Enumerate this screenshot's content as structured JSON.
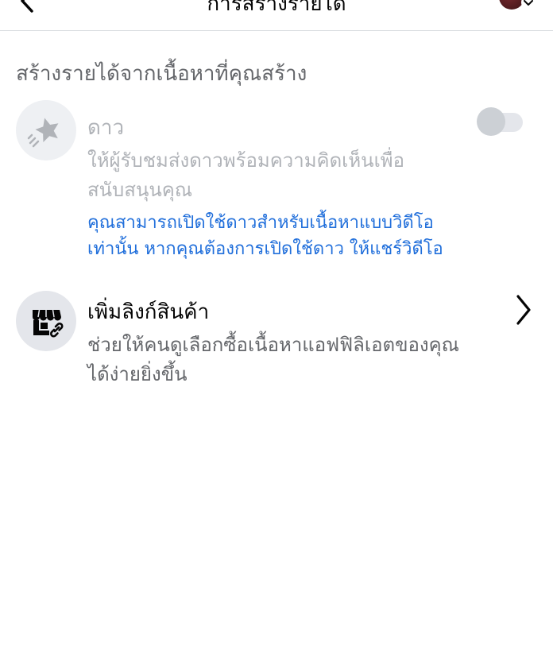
{
  "header": {
    "title": "การสร้างรายได้",
    "back_icon": "chevron-left-icon",
    "avatar_icon": "profile-avatar",
    "avatar_menu_icon": "chevron-down-icon"
  },
  "section": {
    "heading": "สร้างรายได้จากเนื้อหาที่คุณสร้าง"
  },
  "stars": {
    "icon": "star-icon",
    "title": "ดาว",
    "description": "ให้ผู้รับชมส่งดาวพร้อมความคิดเห็นเพื่อสนับสนุนคุณ",
    "note": "คุณสามารถเปิดใช้ดาวสำหรับเนื้อหาแบบวิดีโอเท่านั้น หากคุณต้องการเปิดใช้ดาว ให้แชร์วิดีโอ",
    "toggle_on": false
  },
  "product_links": {
    "icon": "shop-link-icon",
    "title": "เพิ่มลิงก์สินค้า",
    "description": "ช่วยให้คนดูเลือกซื้อเนื้อหาแอฟฟิลิเอตของคุณได้ง่ายยิ่งขึ้น",
    "chevron_icon": "chevron-right-icon"
  },
  "colors": {
    "primary_text": "#050505",
    "secondary_text": "#65676b",
    "disabled_text": "#b0b3b8",
    "link_blue": "#216fdb",
    "icon_bg": "#e4e6eb",
    "divider": "#dadde1"
  }
}
